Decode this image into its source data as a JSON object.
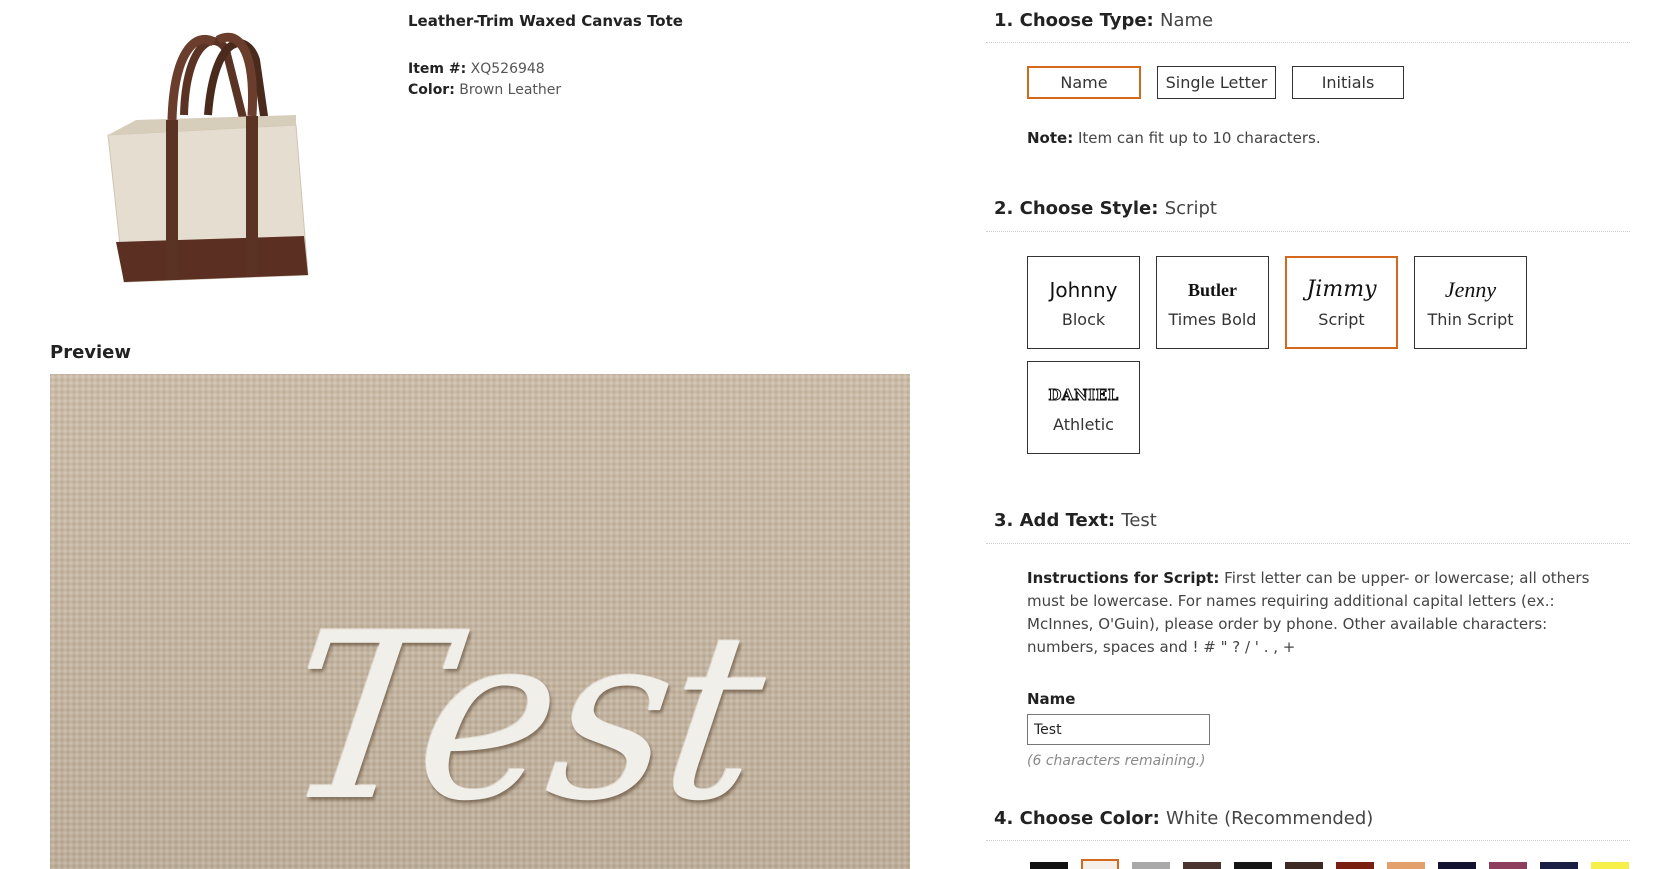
{
  "product": {
    "title": "Leather-Trim Waxed Canvas Tote",
    "item_label": "Item #:",
    "item_value": "XQ526948",
    "color_label": "Color:",
    "color_value": "Brown Leather"
  },
  "preview": {
    "heading": "Preview",
    "text": "Test"
  },
  "type_section": {
    "heading": "1. Choose Type:",
    "value": "Name",
    "options": [
      "Name",
      "Single Letter",
      "Initials"
    ],
    "selected": "Name",
    "note_label": "Note:",
    "note_text": "Item can fit up to 10 characters."
  },
  "style_section": {
    "heading": "2. Choose Style:",
    "value": "Script",
    "options": [
      {
        "sample": "Johnny",
        "label": "Block"
      },
      {
        "sample": "Butler",
        "label": "Times Bold"
      },
      {
        "sample": "Jimmy",
        "label": "Script"
      },
      {
        "sample": "Jenny",
        "label": "Thin Script"
      },
      {
        "sample": "DANIEL",
        "label": "Athletic"
      }
    ],
    "selected": "Script"
  },
  "text_section": {
    "heading": "3. Add Text:",
    "value": "Test",
    "instructions_label": "Instructions for Script:",
    "instructions_text": "First letter can be upper- or lowercase; all others must be lowercase. For names requiring additional capital letters (ex.: McInnes, O'Guin), please order by phone. Other available characters: numbers, spaces and ! # \" ? / ' . , +",
    "name_label": "Name",
    "name_value": "Test",
    "remaining": "(6 characters remaining.)"
  },
  "color_section": {
    "heading": "4. Choose Color:",
    "value": "White (Recommended)",
    "swatches": [
      "#111111",
      "#f5f1ea",
      "#a9a9a9",
      "#4a3530",
      "#151515",
      "#3e2a24",
      "#7a2010",
      "#e3a06a",
      "#12132e",
      "#8e3f5f",
      "#1a1f44",
      "#f7f04a"
    ],
    "selected_index": 1
  },
  "colors": {
    "accent": "#d2691e"
  }
}
